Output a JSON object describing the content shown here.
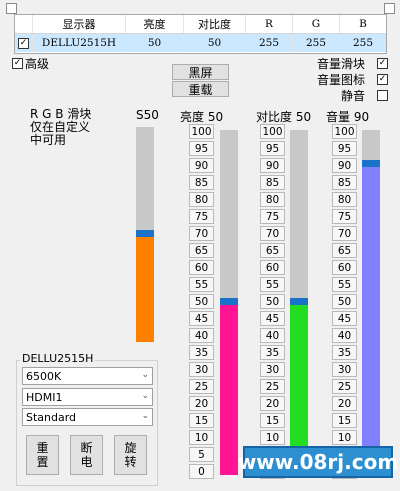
{
  "table": {
    "headers": [
      "显示器",
      "亮度",
      "对比度",
      "R",
      "G",
      "B"
    ],
    "row": {
      "checked": true,
      "monitor": "DELLU2515H",
      "brightness": "50",
      "contrast": "50",
      "r": "255",
      "g": "255",
      "b": "255"
    }
  },
  "advanced": {
    "label": "高级",
    "checked": true
  },
  "right_options": [
    {
      "label": "音量滑块",
      "checked": true
    },
    {
      "label": "音量图标",
      "checked": true
    },
    {
      "label": "静音",
      "checked": false
    }
  ],
  "buttons": {
    "black_screen": "黑屏",
    "reload": "重载"
  },
  "rgb_note": [
    "R G B 滑块",
    "仅在自定义",
    "中可用"
  ],
  "sliders": {
    "s": {
      "title": "S50",
      "value": 50,
      "color": "#ff8000"
    },
    "brightness": {
      "title": "亮度 50",
      "value": 50,
      "color": "#ff1493"
    },
    "contrast": {
      "title": "对比度 50",
      "value": 50,
      "color": "#22dd22"
    },
    "volume": {
      "title": "音量 90",
      "value": 90,
      "color": "#8080ff"
    }
  },
  "ticks": [
    "100",
    "95",
    "90",
    "85",
    "80",
    "75",
    "70",
    "65",
    "60",
    "55",
    "50",
    "45",
    "40",
    "35",
    "30",
    "25",
    "20",
    "15",
    "10",
    "5",
    "0"
  ],
  "group": {
    "title": "DELLU2515H",
    "selects": [
      "6500K",
      "HDMI1",
      "Standard"
    ],
    "buttons": [
      "重置",
      "断电",
      "旋转"
    ]
  },
  "watermark": "www.08rj.com"
}
